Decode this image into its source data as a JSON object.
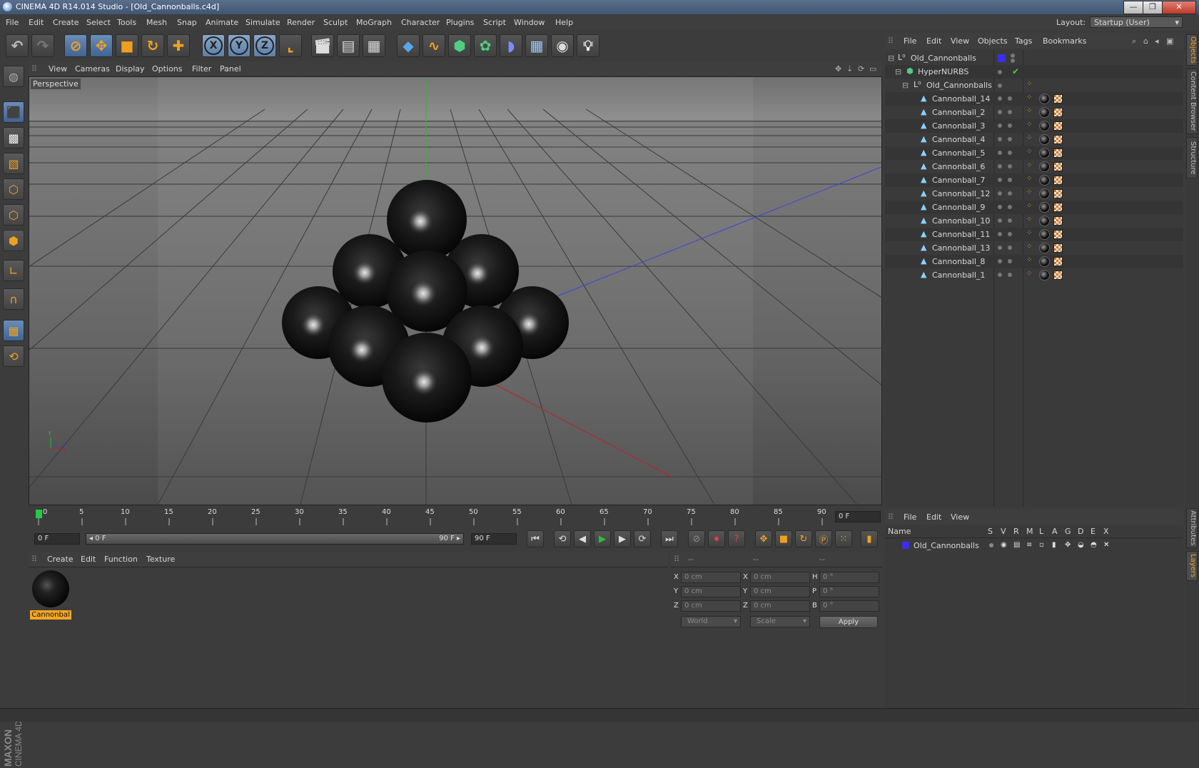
{
  "window": {
    "title": "CINEMA 4D R14.014 Studio - [Old_Cannonballs.c4d]",
    "min": "—",
    "max": "❐",
    "close": "✕"
  },
  "menu": [
    "File",
    "Edit",
    "Create",
    "Select",
    "Tools",
    "Mesh",
    "Snap",
    "Animate",
    "Simulate",
    "Render",
    "Sculpt",
    "MoGraph",
    "Character",
    "Plugins",
    "Script",
    "Window",
    "Help"
  ],
  "layout": {
    "label": "Layout:",
    "value": "Startup (User)"
  },
  "toolbar_axes": [
    "X",
    "Y",
    "Z"
  ],
  "viewport": {
    "menu": [
      "View",
      "Cameras",
      "Display",
      "Options",
      "Filter",
      "Panel"
    ],
    "label": "Perspective",
    "axis_labels": {
      "y": "Y",
      "z": "Z",
      "x": "X"
    }
  },
  "timeline": {
    "ticks": [
      "0",
      "5",
      "10",
      "15",
      "20",
      "25",
      "30",
      "35",
      "40",
      "45",
      "50",
      "55",
      "60",
      "65",
      "70",
      "75",
      "80",
      "85",
      "90"
    ],
    "current_frame": "0 F",
    "start_field": "0 F",
    "range_start": "◂ 0 F",
    "range_end": "90 F ▸",
    "end_field": "90 F"
  },
  "material_panel": {
    "menu": [
      "Create",
      "Edit",
      "Function",
      "Texture"
    ],
    "material_name": "Cannonbal"
  },
  "coordinates": {
    "headers": [
      "--",
      "--",
      "--"
    ],
    "rows": [
      {
        "l1": "X",
        "v1": "0 cm",
        "l2": "X",
        "v2": "0 cm",
        "l3": "H",
        "v3": "0 °"
      },
      {
        "l1": "Y",
        "v1": "0 cm",
        "l2": "Y",
        "v2": "0 cm",
        "l3": "P",
        "v3": "0 °"
      },
      {
        "l1": "Z",
        "v1": "0 cm",
        "l2": "Z",
        "v2": "0 cm",
        "l3": "B",
        "v3": "0 °"
      }
    ],
    "space": "World",
    "mode": "Scale",
    "apply": "Apply"
  },
  "object_manager": {
    "menu": [
      "File",
      "Edit",
      "View",
      "Objects",
      "Tags",
      "Bookmarks"
    ],
    "root": "Old_Cannonballs",
    "hypernurbs": "HyperNURBS",
    "group": "Old_Cannonballs",
    "objects": [
      "Cannonball_14",
      "Cannonball_2",
      "Cannonball_3",
      "Cannonball_4",
      "Cannonball_5",
      "Cannonball_6",
      "Cannonball_7",
      "Cannonball_12",
      "Cannonball_9",
      "Cannonball_10",
      "Cannonball_11",
      "Cannonball_13",
      "Cannonball_8",
      "Cannonball_1"
    ],
    "layer_color": "#3a2ee8"
  },
  "layer_manager": {
    "menu": [
      "File",
      "Edit",
      "View"
    ],
    "columns": [
      "Name",
      "S",
      "V",
      "R",
      "M",
      "L",
      "A",
      "G",
      "D",
      "E",
      "X"
    ],
    "layers": [
      {
        "name": "Old_Cannonballs",
        "color": "#3a2ee8"
      }
    ]
  },
  "side_tabs": [
    "Objects",
    "Content Browser",
    "Structure",
    "Attributes",
    "Layers"
  ],
  "brand": {
    "maxon": "MAXON",
    "product": "CINEMA 4D"
  },
  "colors": {
    "accent": "#f0a020",
    "selection": "#5478a8",
    "x_axis": "#d02020",
    "y_axis": "#20c020",
    "z_axis": "#2030d0"
  }
}
